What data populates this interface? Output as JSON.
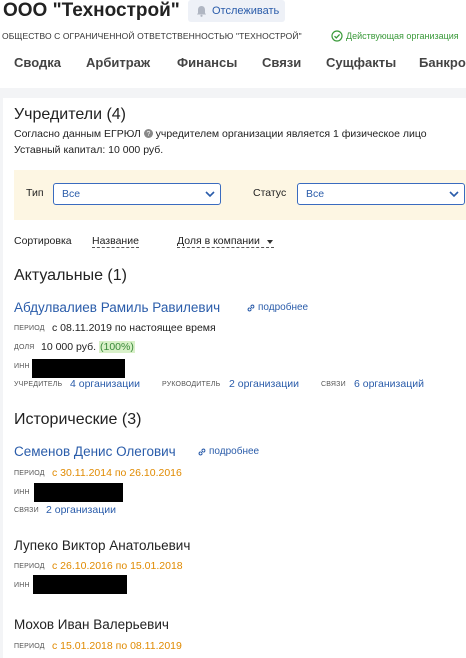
{
  "header": {
    "company": "ООО \"Технострой\"",
    "track_label": "Отслеживать",
    "full_name": "ОБЩЕСТВО С ОГРАНИЧЕННОЙ ОТВЕТСТВЕННОСТЬЮ \"ТЕХНОСТРОЙ\"",
    "status": "Действующая организация"
  },
  "tabs": [
    "Сводка",
    "Арбитраж",
    "Финансы",
    "Связи",
    "Сущфакты",
    "Банкро"
  ],
  "founders": {
    "title": "Учредители (4)",
    "info_line": "Согласно данным ЕГРЮЛ",
    "info_line2": "учредителем организации является 1 физическое лицо",
    "capital": "Уставный капитал: 10 000 руб."
  },
  "filters": {
    "type_label": "Тип",
    "type_value": "Все",
    "status_label": "Статус",
    "status_value": "Все"
  },
  "sort": {
    "label": "Сортировка",
    "by_name": "Название",
    "by_share": "Доля в компании"
  },
  "actual": {
    "title": "Актуальные (1)",
    "person": {
      "name": "Абдулвалиев Рамиль Равилевич",
      "more": "подробнее",
      "period_label": "период",
      "period": "с 08.11.2019 по настоящее время",
      "share_label": "доля",
      "share": "10 000 руб.",
      "share_pct": "(100%)",
      "inn_label": "инн",
      "founder_label": "учредитель",
      "founder_link": "4 организации",
      "head_label": "руководитель",
      "head_link": "2 организации",
      "links_label": "связи",
      "links_link": "6 организаций"
    }
  },
  "historic": {
    "title": "Исторические (3)",
    "people": [
      {
        "name": "Семенов Денис Олегович",
        "more": "подробнее",
        "period_label": "период",
        "period": "с 30.11.2014 по 26.10.2016",
        "inn_label": "инн",
        "links_label": "связи",
        "links_link": "2 организации"
      },
      {
        "name": "Лупеко Виктор Анатольевич",
        "period_label": "период",
        "period": "с 26.10.2016 по 15.01.2018",
        "inn_label": "инн"
      },
      {
        "name": "Мохов Иван Валерьевич",
        "period_label": "период",
        "period": "с 15.01.2018 по 08.11.2019"
      }
    ]
  }
}
